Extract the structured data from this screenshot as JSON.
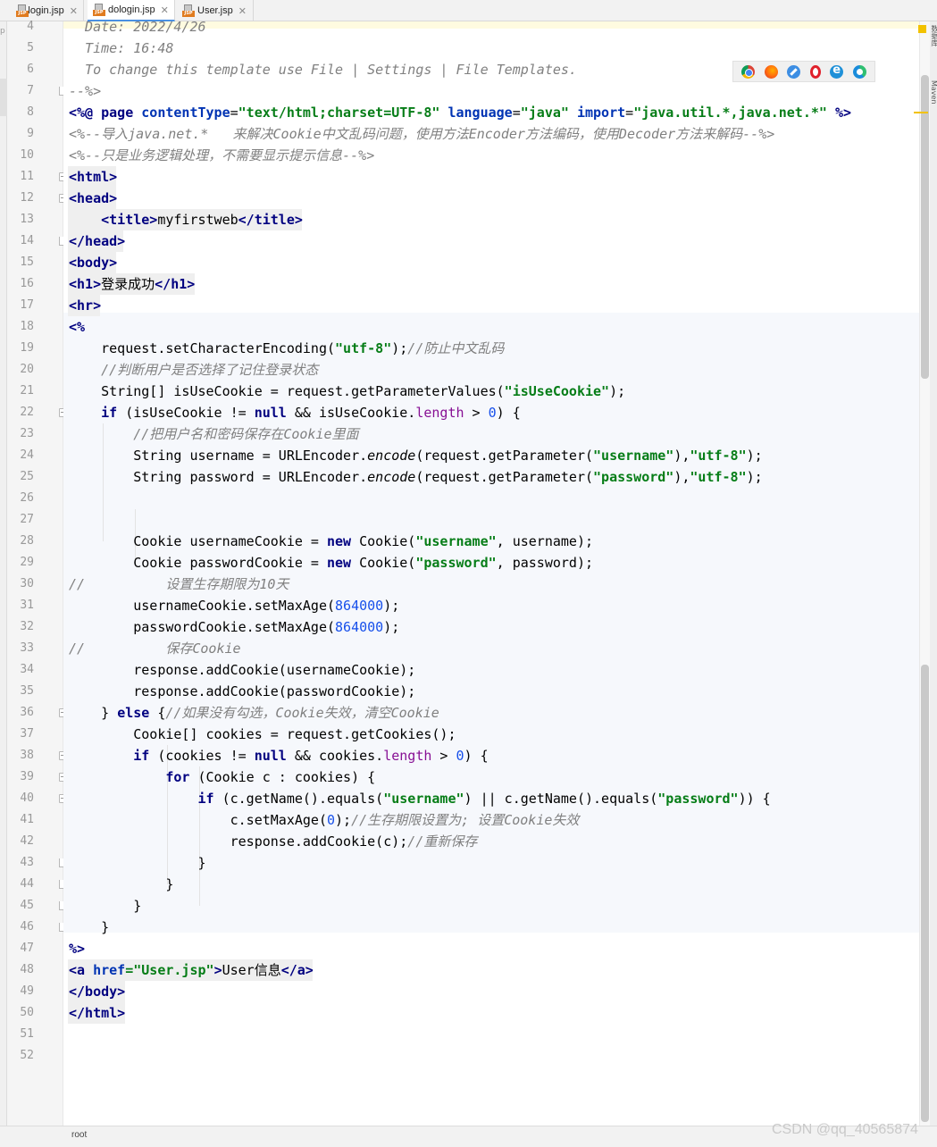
{
  "tabs": [
    {
      "label": "login.jsp",
      "active": false
    },
    {
      "label": "dologin.jsp",
      "active": true
    },
    {
      "label": "User.jsp",
      "active": false
    }
  ],
  "left_strip_text": "p",
  "right_strip_labels": [
    "数据库",
    "Maven"
  ],
  "line_numbers": [
    "4",
    "5",
    "6",
    "7",
    "8",
    "9",
    "10",
    "11",
    "12",
    "13",
    "14",
    "15",
    "16",
    "17",
    "18",
    "19",
    "20",
    "21",
    "22",
    "23",
    "24",
    "25",
    "26",
    "27",
    "28",
    "29",
    "30",
    "31",
    "32",
    "33",
    "34",
    "35",
    "36",
    "37",
    "38",
    "39",
    "40",
    "41",
    "42",
    "43",
    "44",
    "45",
    "46",
    "47",
    "48",
    "49",
    "50",
    "51",
    "52"
  ],
  "browser_icons": [
    "chrome-icon",
    "firefox-icon",
    "safari-icon",
    "opera-icon",
    "internet-explorer-icon",
    "edge-icon"
  ],
  "code_lines": [
    [
      [
        "c-com",
        "  Date: 2022/4/26"
      ]
    ],
    [
      [
        "c-com",
        "  Time: 16:48"
      ]
    ],
    [
      [
        "c-com",
        "  To change this template use File | Settings | File Templates."
      ]
    ],
    [
      [
        "c-com",
        "--%>"
      ]
    ],
    [
      [
        "c-dir",
        "<%@ "
      ],
      [
        "c-kw",
        "page "
      ],
      [
        "c-attr",
        "contentType"
      ],
      [
        "",
        "="
      ],
      [
        "c-attrv",
        "\"text/html;charset=UTF-8\""
      ],
      [
        "",
        " "
      ],
      [
        "c-attr",
        "language"
      ],
      [
        "",
        "="
      ],
      [
        "c-attrv",
        "\"java\""
      ],
      [
        "",
        " "
      ],
      [
        "c-attr",
        "import"
      ],
      [
        "",
        "="
      ],
      [
        "c-attrv",
        "\"java.util.*,java.net.*\""
      ],
      [
        "",
        " "
      ],
      [
        "c-dir",
        "%>"
      ]
    ],
    [
      [
        "c-com",
        "<%--导入java.net.*   来解决Cookie中文乱码问题，使用方法Encoder方法编码，使用Decoder方法来解码--%>"
      ]
    ],
    [
      [
        "c-com",
        "<%--只是业务逻辑处理，不需要显示提示信息--%>"
      ]
    ],
    [
      [
        "c-tag",
        "<html>"
      ]
    ],
    [
      [
        "c-tag",
        "<head>"
      ]
    ],
    [
      [
        "",
        "    "
      ],
      [
        "c-tag",
        "<title>"
      ],
      [
        "",
        "myfirstweb"
      ],
      [
        "c-tag",
        "</title>"
      ]
    ],
    [
      [
        "c-tag",
        "</head>"
      ]
    ],
    [
      [
        "c-tag",
        "<body>"
      ]
    ],
    [
      [
        "c-tag",
        "<h1>"
      ],
      [
        "",
        "登录成功"
      ],
      [
        "c-tag",
        "</h1>"
      ]
    ],
    [
      [
        "c-tag",
        "<hr>"
      ]
    ],
    [
      [
        "c-dir",
        "<%"
      ]
    ],
    [
      [
        "",
        "    request.setCharacterEncoding("
      ],
      [
        "c-str",
        "\"utf-8\""
      ],
      [
        "",
        ");"
      ],
      [
        "c-com",
        "//防止中文乱码"
      ]
    ],
    [
      [
        "",
        "    "
      ],
      [
        "c-com",
        "//判断用户是否选择了记住登录状态"
      ]
    ],
    [
      [
        "",
        "    String[] isUseCookie = request.getParameterValues("
      ],
      [
        "c-str",
        "\"isUseCookie\""
      ],
      [
        "",
        ");"
      ]
    ],
    [
      [
        "",
        "    "
      ],
      [
        "c-kw",
        "if"
      ],
      [
        "",
        " (isUseCookie != "
      ],
      [
        "c-kw",
        "null"
      ],
      [
        "",
        " && isUseCookie."
      ],
      [
        "c-fld",
        "length"
      ],
      [
        "",
        " > "
      ],
      [
        "c-num",
        "0"
      ],
      [
        "",
        ") {"
      ]
    ],
    [
      [
        "",
        "        "
      ],
      [
        "c-com",
        "//把用户名和密码保存在Cookie里面"
      ]
    ],
    [
      [
        "",
        "        String username = URLEncoder."
      ],
      [
        "c-it",
        "encode"
      ],
      [
        "",
        "(request.getParameter("
      ],
      [
        "c-str",
        "\"username\""
      ],
      [
        "",
        "),"
      ],
      [
        "c-str",
        "\"utf-8\""
      ],
      [
        "",
        ");"
      ]
    ],
    [
      [
        "",
        "        String password = URLEncoder."
      ],
      [
        "c-it",
        "encode"
      ],
      [
        "",
        "(request.getParameter("
      ],
      [
        "c-str",
        "\"password\""
      ],
      [
        "",
        "),"
      ],
      [
        "c-str",
        "\"utf-8\""
      ],
      [
        "",
        ");"
      ]
    ],
    [
      [
        "",
        ""
      ]
    ],
    [
      [
        "",
        ""
      ]
    ],
    [
      [
        "",
        "        Cookie usernameCookie = "
      ],
      [
        "c-kw",
        "new"
      ],
      [
        "",
        " Cookie("
      ],
      [
        "c-str",
        "\"username\""
      ],
      [
        "",
        ", username);"
      ]
    ],
    [
      [
        "",
        "        Cookie passwordCookie = "
      ],
      [
        "c-kw",
        "new"
      ],
      [
        "",
        " Cookie("
      ],
      [
        "c-str",
        "\"password\""
      ],
      [
        "",
        ", password);"
      ]
    ],
    [
      [
        "c-com",
        "//          设置生存期限为10天"
      ]
    ],
    [
      [
        "",
        "        usernameCookie.setMaxAge("
      ],
      [
        "c-num",
        "864000"
      ],
      [
        "",
        ");"
      ]
    ],
    [
      [
        "",
        "        passwordCookie.setMaxAge("
      ],
      [
        "c-num",
        "864000"
      ],
      [
        "",
        ");"
      ]
    ],
    [
      [
        "c-com",
        "//          保存Cookie"
      ]
    ],
    [
      [
        "",
        "        response.addCookie(usernameCookie);"
      ]
    ],
    [
      [
        "",
        "        response.addCookie(passwordCookie);"
      ]
    ],
    [
      [
        "",
        "    } "
      ],
      [
        "c-kw",
        "else"
      ],
      [
        "",
        " {"
      ],
      [
        "c-com",
        "//如果没有勾选，Cookie失效，清空Cookie"
      ]
    ],
    [
      [
        "",
        "        Cookie[] cookies = request.getCookies();"
      ]
    ],
    [
      [
        "",
        "        "
      ],
      [
        "c-kw",
        "if"
      ],
      [
        "",
        " (cookies != "
      ],
      [
        "c-kw",
        "null"
      ],
      [
        "",
        " && cookies."
      ],
      [
        "c-fld",
        "length"
      ],
      [
        "",
        " > "
      ],
      [
        "c-num",
        "0"
      ],
      [
        "",
        ") {"
      ]
    ],
    [
      [
        "",
        "            "
      ],
      [
        "c-kw",
        "for"
      ],
      [
        "",
        " (Cookie c : cookies) {"
      ]
    ],
    [
      [
        "",
        "                "
      ],
      [
        "c-kw",
        "if"
      ],
      [
        "",
        " (c.getName().equals("
      ],
      [
        "c-str",
        "\"username\""
      ],
      [
        "",
        ") || c.getName().equals("
      ],
      [
        "c-str",
        "\"password\""
      ],
      [
        "",
        ")) {"
      ]
    ],
    [
      [
        "",
        "                    c.setMaxAge("
      ],
      [
        "c-num",
        "0"
      ],
      [
        "",
        ");"
      ],
      [
        "c-com",
        "//生存期限设置为; 设置Cookie失效"
      ]
    ],
    [
      [
        "",
        "                    response.addCookie(c);"
      ],
      [
        "c-com",
        "//重新保存"
      ]
    ],
    [
      [
        "",
        "                }"
      ]
    ],
    [
      [
        "",
        "            }"
      ]
    ],
    [
      [
        "",
        "        }"
      ]
    ],
    [
      [
        "",
        "    }"
      ]
    ],
    [
      [
        "c-dir",
        "%>"
      ]
    ],
    [
      [
        "c-tag",
        "<a "
      ],
      [
        "c-attr",
        "href"
      ],
      [
        "c-attrv",
        "=\"User.jsp\""
      ],
      [
        "c-tag",
        ">"
      ],
      [
        "",
        "User信息"
      ],
      [
        "c-tag",
        "</a>"
      ]
    ],
    [
      [
        "c-tag",
        "</body>"
      ]
    ],
    [
      [
        "c-tag",
        "</html>"
      ]
    ],
    [
      [
        "",
        ""
      ]
    ],
    [
      [
        "",
        ""
      ]
    ]
  ],
  "status": {
    "breadcrumb": "root"
  },
  "watermark": "CSDN @qq_40565874",
  "colors": {
    "keyword": "#000080",
    "string": "#067d17",
    "comment": "#808080",
    "number": "#1750eb",
    "field": "#871094"
  }
}
